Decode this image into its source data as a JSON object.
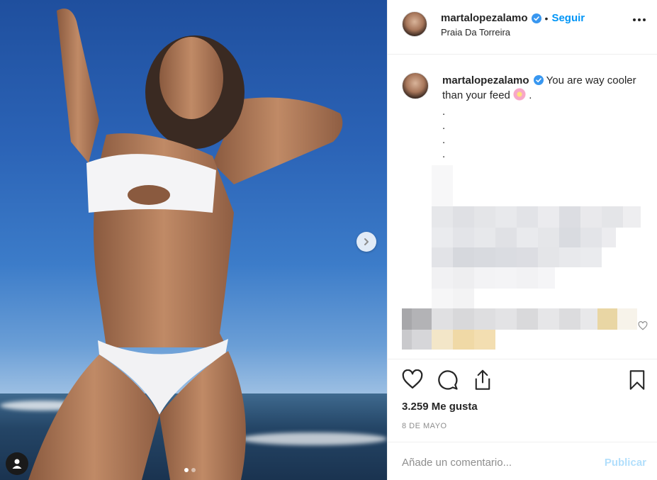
{
  "post": {
    "author": {
      "username": "martalopezalamo",
      "verified": true,
      "follow_label": "Seguir",
      "separator": "•",
      "location": "Praia Da Torreira"
    },
    "more_icon": "ellipsis-icon",
    "caption": {
      "username": "martalopezalamo",
      "text_before_emoji": "You are way cooler than your feed",
      "emoji": "cherry-blossom-icon",
      "text_after_emoji": ".",
      "dots": [
        ".",
        ".",
        ".",
        "."
      ]
    },
    "photo": {
      "carousel_index": 1,
      "carousel_count": 2,
      "next_icon": "chevron-right-icon",
      "tag_icon": "user-tag-icon"
    },
    "actions": {
      "like_icon": "heart-icon",
      "comment_icon": "comment-icon",
      "share_icon": "share-icon",
      "save_icon": "bookmark-icon"
    },
    "likes_text": "3.259 Me gusta",
    "date_text": "8 DE MAYO",
    "comment_box": {
      "placeholder": "Añade un comentario...",
      "publish_label": "Publicar"
    },
    "colors": {
      "accent": "#0095f6",
      "publish_disabled": "#b2dffc",
      "verified_badge": "#3897f0",
      "muted_text": "#8e8e8e"
    }
  }
}
